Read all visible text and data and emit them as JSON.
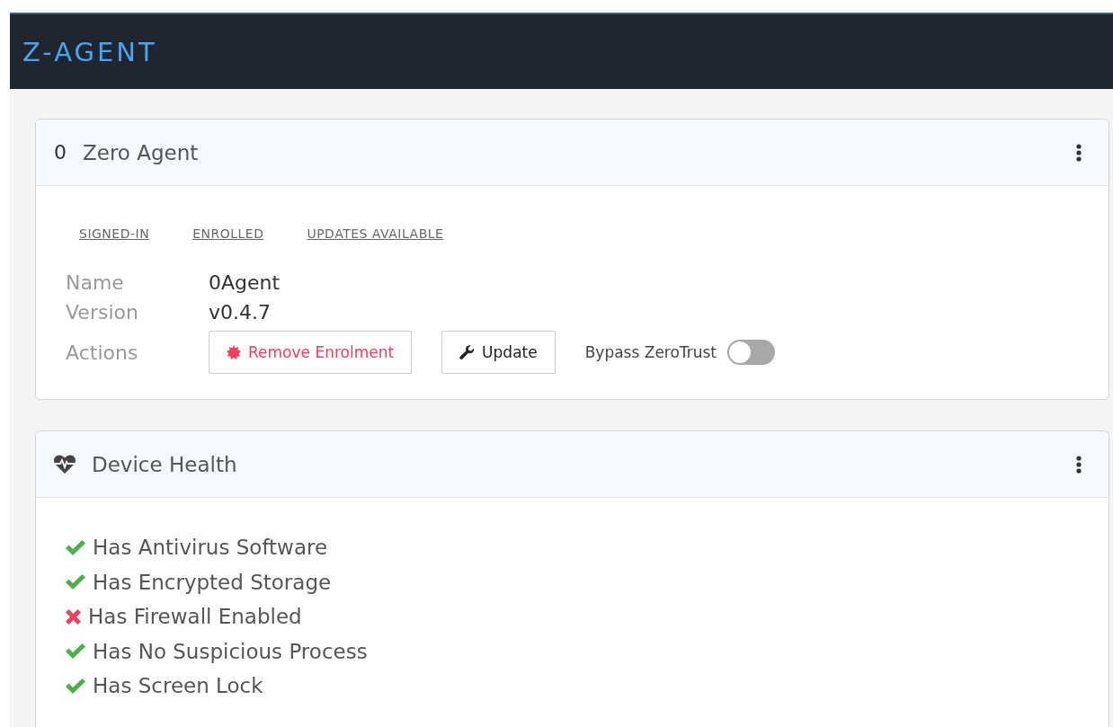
{
  "app_title": "Z-AGENT",
  "agent_card": {
    "badge": "0",
    "title": "Zero Agent",
    "status_links": [
      "SIGNED-IN",
      "ENROLLED",
      "UPDATES AVAILABLE"
    ],
    "fields": [
      {
        "label": "Name",
        "value": "0Agent"
      },
      {
        "label": "Version",
        "value": "v0.4.7"
      }
    ],
    "actions_label": "Actions",
    "buttons": [
      {
        "kind": "danger",
        "label": "Remove Enrolment"
      },
      {
        "kind": "update",
        "label": "Update"
      }
    ],
    "toggle": {
      "label": "Bypass ZeroTrust",
      "on": false
    }
  },
  "health_card": {
    "title": "Device Health",
    "checks": [
      {
        "label": "Has Antivirus Software",
        "passed": true
      },
      {
        "label": "Has Encrypted Storage",
        "passed": true
      },
      {
        "label": "Has Firewall Enabled",
        "passed": false
      },
      {
        "label": "Has No Suspicious Process",
        "passed": true
      },
      {
        "label": "Has Screen Lock",
        "passed": true
      }
    ]
  }
}
